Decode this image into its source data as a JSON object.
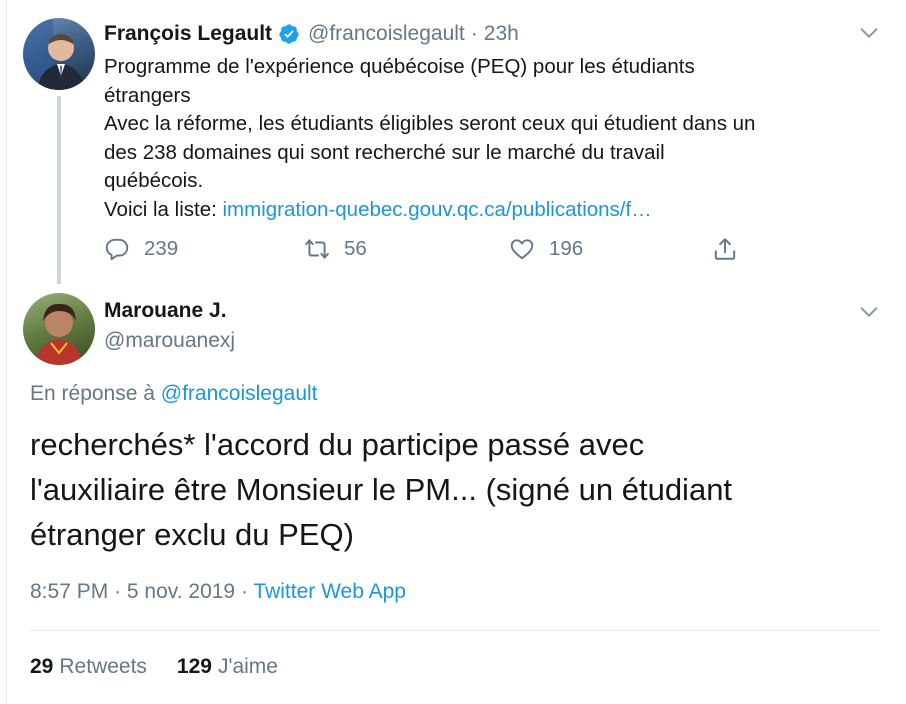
{
  "parent_tweet": {
    "author_name": "François Legault",
    "handle": "@francoislegault",
    "separator": "·",
    "time": "23h",
    "text_lines": [
      "Programme de l'expérience québécoise (PEQ) pour les étudiants",
      "étrangers",
      "Avec la réforme, les étudiants éligibles seront ceux qui étudient dans un",
      "des 238 domaines qui sont recherché sur le marché du travail",
      "québécois."
    ],
    "link_prefix": "Voici la liste: ",
    "link_text": "immigration-quebec.gouv.qc.ca/publications/f…",
    "replies": "239",
    "retweets": "56",
    "likes": "196"
  },
  "reply_tweet": {
    "author_name": "Marouane J.",
    "handle": "@marouanexj",
    "reply_prefix": "En réponse à ",
    "reply_to_handle": "@francoislegault",
    "text_lines": [
      "recherchés* l'accord du participe passé avec",
      "l'auxiliaire être Monsieur le PM... (signé un étudiant",
      "étranger exclu du PEQ)"
    ],
    "time": "8:57 PM",
    "date": "5 nov. 2019",
    "separator": "·",
    "source": "Twitter Web App",
    "retweets_count": "29",
    "retweets_label": "Retweets",
    "likes_count": "129",
    "likes_label": "J'aime"
  },
  "colors": {
    "accent": "#1b95e0",
    "muted": "#657786",
    "text": "#14171a",
    "thread_line": "#cbd6de"
  },
  "icons": [
    "verified-badge-icon",
    "chevron-down-icon",
    "reply-icon",
    "retweet-icon",
    "like-icon",
    "share-icon"
  ]
}
